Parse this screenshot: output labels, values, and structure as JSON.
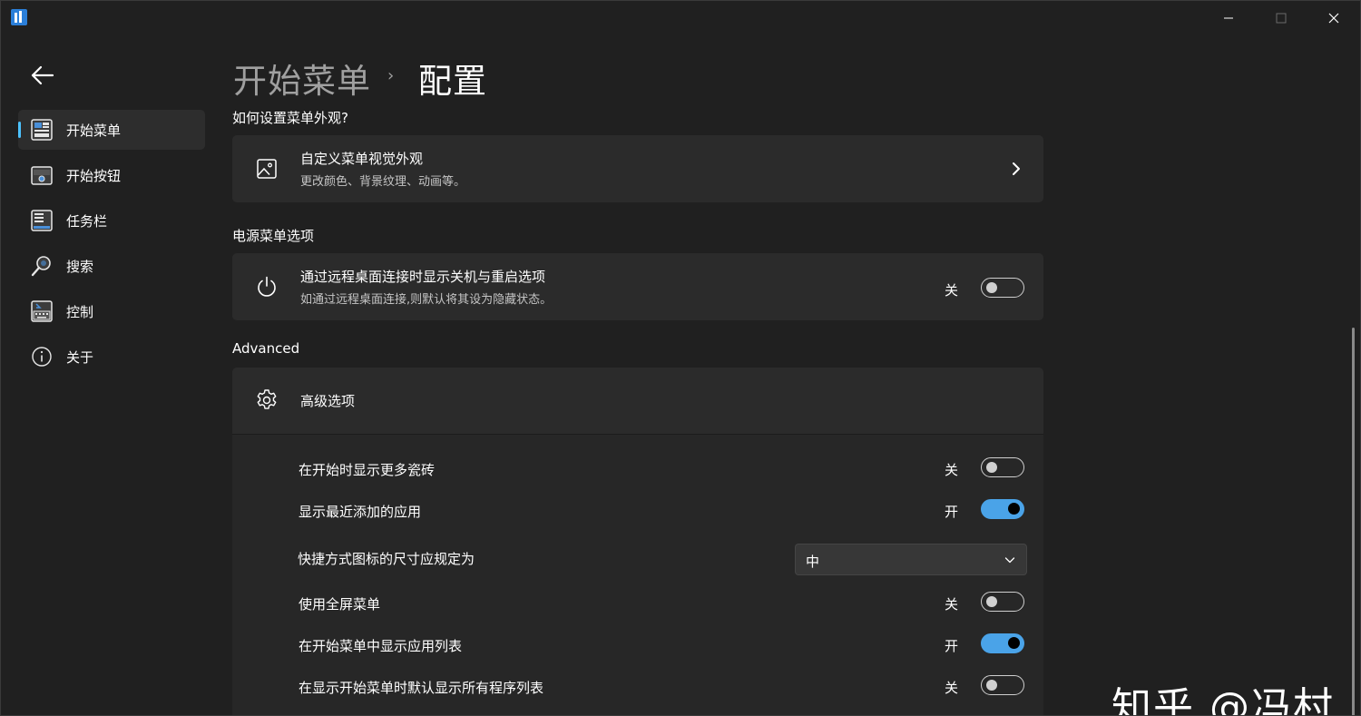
{
  "window": {
    "controls": {
      "minimize": "minimize",
      "maximize": "maximize",
      "close": "close"
    }
  },
  "nav": {
    "items": [
      {
        "label": "开始菜单",
        "icon": "start-menu-icon",
        "active": true
      },
      {
        "label": "开始按钮",
        "icon": "start-button-icon",
        "active": false
      },
      {
        "label": "任务栏",
        "icon": "taskbar-icon",
        "active": false
      },
      {
        "label": "搜索",
        "icon": "search-icon",
        "active": false
      },
      {
        "label": "控制",
        "icon": "keyboard-icon",
        "active": false
      },
      {
        "label": "关于",
        "icon": "info-icon",
        "active": false
      }
    ]
  },
  "header": {
    "breadcrumb_parent": "开始菜单",
    "breadcrumb_separator": "›",
    "breadcrumb_current": "配置"
  },
  "appearance": {
    "section_title": "如何设置菜单外观?",
    "card_title": "自定义菜单视觉外观",
    "card_subtitle": "更改颜色、背景纹理、动画等。"
  },
  "power": {
    "section_title": "电源菜单选项",
    "card_title": "通过远程桌面连接时显示关机与重启选项",
    "card_subtitle": "如通过远程桌面连接,则默认将其设为隐藏状态。",
    "state_label": "关",
    "on": false
  },
  "advanced": {
    "section_title": "Advanced",
    "expander_title": "高级选项",
    "rows": [
      {
        "label": "在开始时显示更多瓷砖",
        "state_label": "关",
        "on": false
      },
      {
        "label": "显示最近添加的应用",
        "state_label": "开",
        "on": true
      },
      {
        "label": "快捷方式图标的尺寸应规定为",
        "dropdown_value": "中"
      },
      {
        "label": "使用全屏菜单",
        "state_label": "关",
        "on": false
      },
      {
        "label": "在开始菜单中显示应用列表",
        "state_label": "开",
        "on": true
      },
      {
        "label": "在显示开始菜单时默认显示所有程序列表",
        "state_label": "关",
        "on": false
      }
    ]
  },
  "watermark": "知乎 @冯村",
  "colors": {
    "accent": "#4aa3e8",
    "background": "#202020",
    "card": "#2b2b2b"
  }
}
